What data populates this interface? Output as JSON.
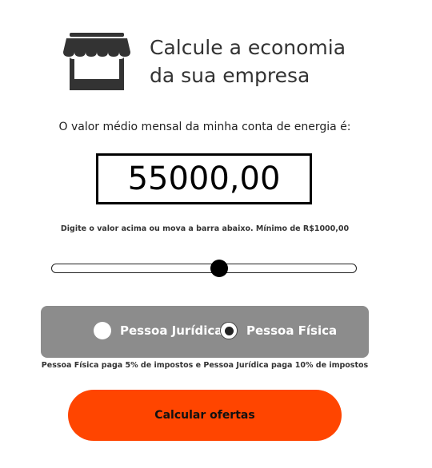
{
  "header": {
    "icon": "store-icon",
    "title_line1": "Calcule a economia",
    "title_line2": "da sua empresa"
  },
  "bill": {
    "question": "O valor médio mensal da minha conta de energia é:",
    "value": "55000,00",
    "hint": "Digite o valor acima ou mova a barra abaixo. Mínimo de R$1000,00"
  },
  "slider": {
    "level": 0.55
  },
  "person_type": {
    "options": [
      {
        "label": "Pessoa Jurídica",
        "checked": false
      },
      {
        "label": "Pessoa Física",
        "checked": true
      }
    ],
    "note": "Pessoa Física paga 5% de impostos e Pessoa Jurídica paga 10% de impostos"
  },
  "cta": {
    "label": "Calcular ofertas"
  },
  "colors": {
    "accent": "#ff4500",
    "panel": "#8c8c8c",
    "icon": "#333333"
  }
}
